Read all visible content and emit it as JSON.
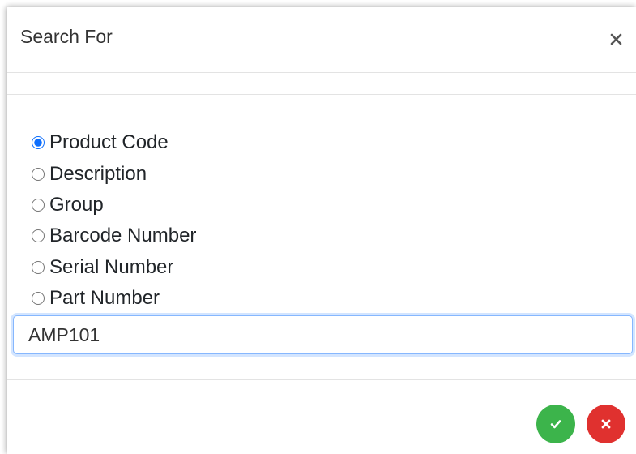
{
  "dialog": {
    "title": "Search For",
    "close_icon": "close-icon"
  },
  "search_options": {
    "selected": "product_code",
    "options": [
      {
        "value": "product_code",
        "label": "Product Code"
      },
      {
        "value": "description",
        "label": "Description"
      },
      {
        "value": "group",
        "label": "Group"
      },
      {
        "value": "barcode_number",
        "label": "Barcode Number"
      },
      {
        "value": "serial_number",
        "label": "Serial Number"
      },
      {
        "value": "part_number",
        "label": "Part Number"
      }
    ]
  },
  "search_input": {
    "value": "AMP101"
  },
  "footer": {
    "confirm_icon": "check-icon",
    "cancel_icon": "x-icon",
    "confirm_color": "#3cb44b",
    "cancel_color": "#e0312f"
  }
}
